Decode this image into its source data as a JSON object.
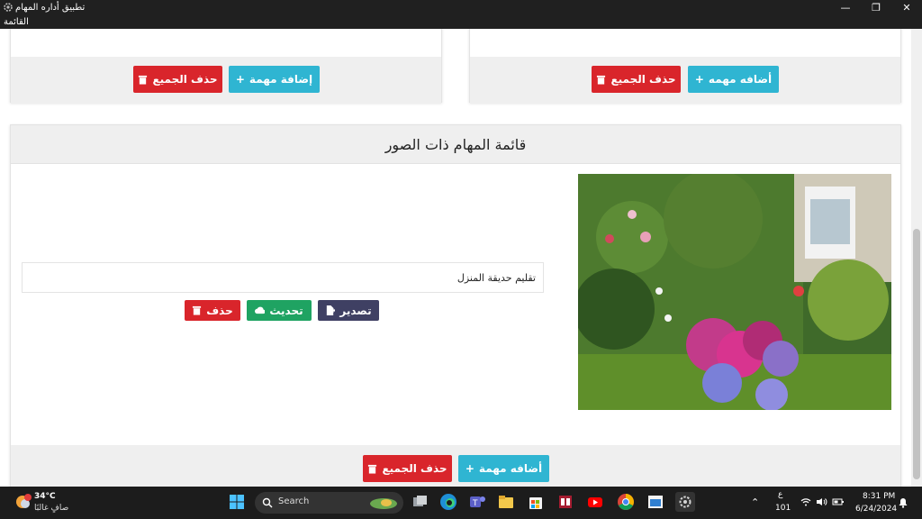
{
  "window": {
    "title": "تطبيق أداره المهام",
    "menu_label": "القائمة"
  },
  "top_left_card": {
    "delete_all_label": "حذف الجميع",
    "add_task_label": "إضافة مهمة"
  },
  "top_right_card": {
    "delete_all_label": "حذف الجميع",
    "add_task_label": "أضافه مهمه"
  },
  "image_card": {
    "title": "قائمة المهام ذات الصور",
    "task_value": "تقليم حديقة المنزل",
    "export_label": "تصدير",
    "update_label": "تحديث",
    "delete_label": "حذف",
    "delete_all_label": "حذف الجميع",
    "add_task_label": "أضافه مهمة"
  },
  "taskbar": {
    "temperature": "34°C",
    "weather_desc": "صافٍ غالبًا",
    "search_label": "Search",
    "lang_top": "ع",
    "lang_bottom": "101",
    "time": "8:31 PM",
    "date": "6/24/2024"
  },
  "colors": {
    "danger": "#d9252b",
    "info": "#2fb5d2",
    "success": "#1fa362",
    "navy": "#3f4063"
  }
}
